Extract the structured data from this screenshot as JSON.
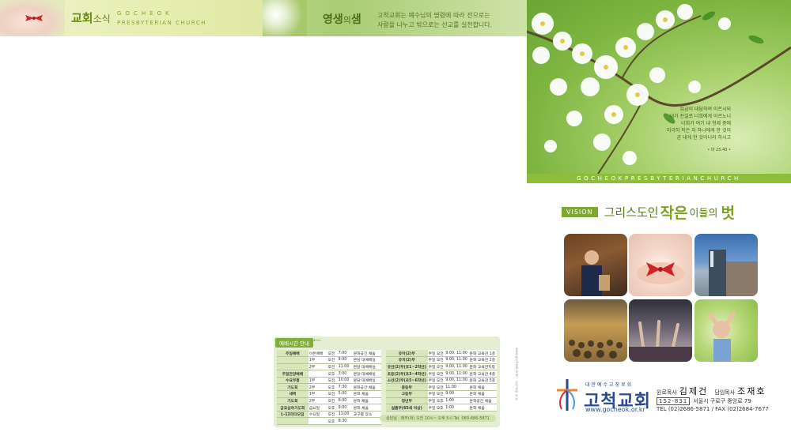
{
  "header_left": {
    "title_main": "교회",
    "title_sub": "소식",
    "eng_line1": "GOCHEOK",
    "eng_line2": "PRESBYTERIAN CHURCH"
  },
  "header_mid": {
    "title_main": "영생",
    "title_mid": "의",
    "title_end": "샘",
    "desc_line1": "고척교회는 예수님의 명령에 따라 전으로는",
    "desc_line2": "사랑을 나누고 밖으로는 선교를 실천합니다."
  },
  "cover": {
    "verse_lines": [
      "임금이 대답하여 이르시되",
      "내가 진실로 너희에게 이르노니",
      "너희가 여기 내 형제 중에",
      "지극히 작은 자 하나에게 한 것이",
      "곧 내게 한 것이니라 하시고"
    ],
    "citation": "• 마 25:40 •"
  },
  "eng_bar": "GOCHEOKPRESBYTERIANCHURCH",
  "vision": {
    "tag": "VISION",
    "t1": "그리스도인",
    "t2": "작은",
    "t3": "이들의",
    "t4": "벗"
  },
  "logo": {
    "sub": "대한예수교장로회",
    "name": "고척교회",
    "url": "www.gocheok.or.kr"
  },
  "contact": {
    "pastor1_title": "원로목사",
    "pastor1_name": "김제건",
    "pastor2_title": "담임목사",
    "pastor2_name": "조재호",
    "zip": "152-831",
    "address": "서울시 구로구 중앙로 79",
    "tel": "TEL (02)2686-5871 / FAX (02)2684-7677"
  },
  "schedule": {
    "heading": "예배시간 안내",
    "left_rows": [
      [
        "주일예배",
        "이른예배",
        "오전",
        "7:00",
        "문화공간 채움"
      ],
      [
        "",
        "1부",
        "오전",
        "9:00",
        "본당 대예배실"
      ],
      [
        "",
        "2부",
        "오전",
        "11:00",
        "본당 대예배실"
      ],
      [
        "주일찬양예배",
        "",
        "오후",
        "3:00",
        "본당 대예배실"
      ],
      [
        "수요부흥",
        "1부",
        "오전",
        "10:00",
        "본당 대예배실"
      ],
      [
        "기도회",
        "2부",
        "오후",
        "7:30",
        "문화공간 채움"
      ],
      [
        "새벽",
        "1부",
        "오전",
        "5:00",
        "문화 채움"
      ],
      [
        "기도회",
        "2부",
        "오전",
        "6:00",
        "문화 채움"
      ],
      [
        "금요심야기도회",
        "금요일",
        "오후",
        "9:00",
        "문화 채움"
      ],
      [
        "L-12리더모임",
        "수요일",
        "오전",
        "11:00",
        "교구별 장소"
      ],
      [
        "",
        "",
        "오후",
        "8:30",
        ""
      ]
    ],
    "right_rows": [
      [
        "유아(2)부",
        "주일 오전",
        "9:00, 11:00",
        "문화 교육관 1층"
      ],
      [
        "유치(2)부",
        "주일 오전",
        "9:00, 11:00",
        "문화 교육관 2층"
      ],
      [
        "유년(2)부(초1~2학년)",
        "주일 오전",
        "9:00, 11:00",
        "문화 교육관지층"
      ],
      [
        "초등(2)부(초3~4학년)",
        "주일 오전",
        "9:00, 11:00",
        "문화 교육관 4층"
      ],
      [
        "소년(2)부(초5~6학년)",
        "주일 오전",
        "9:00, 11:00",
        "문화 교육관 5층"
      ],
      [
        "중등부",
        "주일 오전",
        "11:00",
        "문화 채움"
      ],
      [
        "고등부",
        "주일 오전",
        "9:00",
        "문화 채움"
      ],
      [
        "청년부",
        "주일 오후",
        "1:00",
        "문화공간 채움"
      ],
      [
        "실롬부(65세 이상)",
        "주일 오후",
        "1:00",
        "문화 채움"
      ]
    ],
    "note": "상담실 : 매주(화) 오전 10시~ 오후 5시   Tel. 080-686-5871"
  },
  "side_text": "www.gocheok.or.kr  ·  고척교회 주보"
}
